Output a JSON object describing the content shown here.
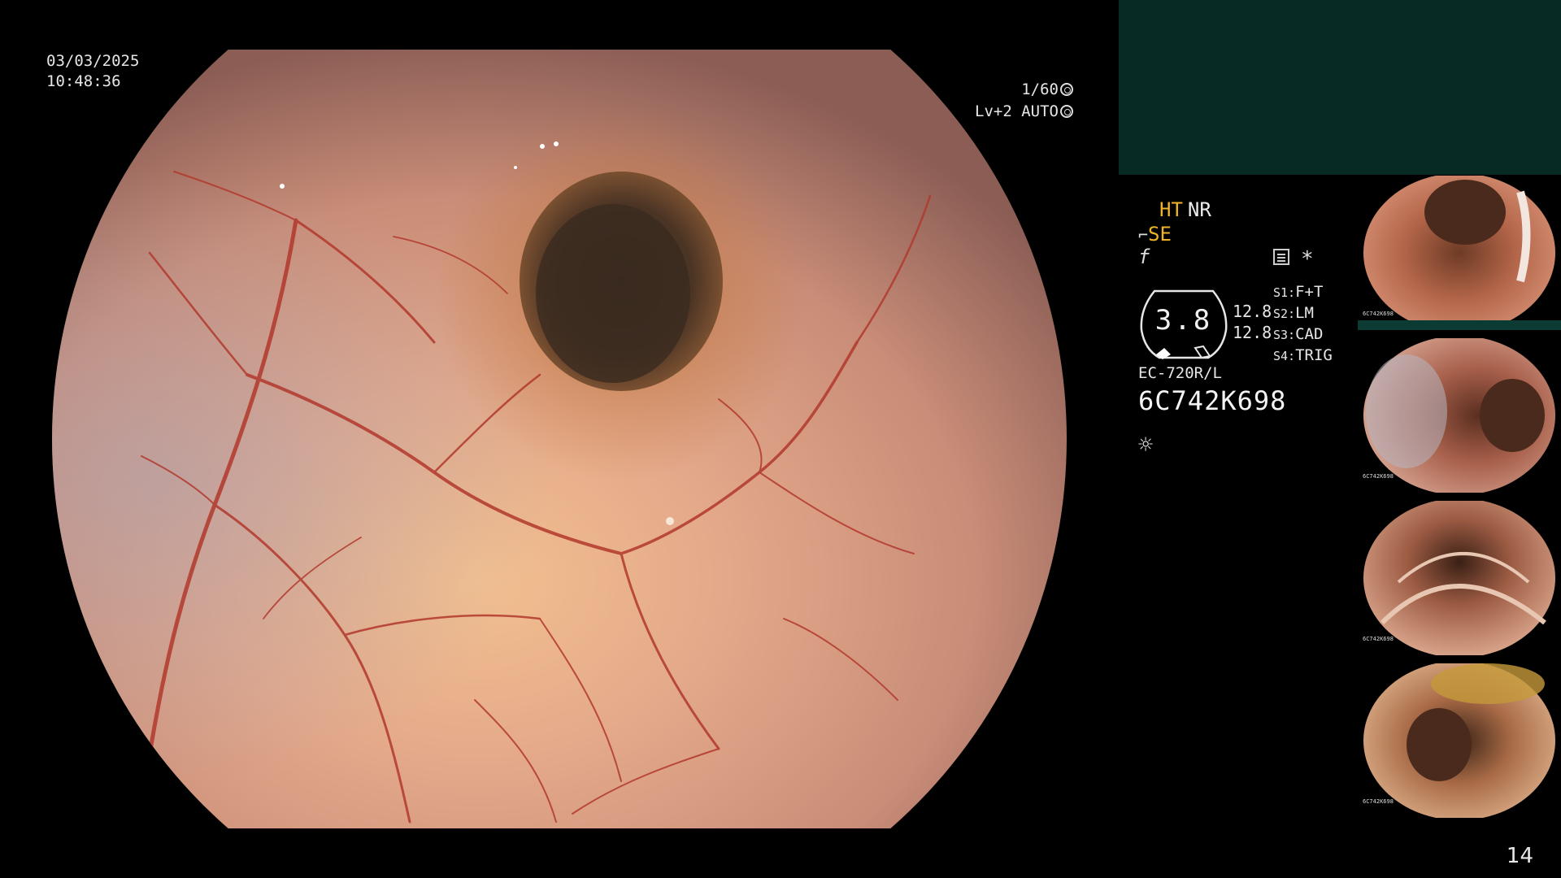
{
  "overlay": {
    "date": "03/03/2025",
    "time": "10:48:36",
    "shutter": "1/60",
    "level": "Lv+2 AUTO"
  },
  "status": {
    "ht": "HT",
    "nr": "NR",
    "se_glyph": "⌐",
    "se": "SE",
    "f_glyph": "f",
    "asterisk": "*",
    "gauge_value": "3.8",
    "value1": "12.8",
    "value2": "12.8",
    "slots": [
      {
        "key": "S1:",
        "value": "F+T"
      },
      {
        "key": "S2:",
        "value": "LM"
      },
      {
        "key": "S3:",
        "value": "CAD"
      },
      {
        "key": "S4:",
        "value": "TRIG"
      }
    ],
    "model": "EC-720R/L",
    "serial": "6C742K698",
    "light_icon": "sun-icon"
  },
  "thumbnails": [
    {
      "label": "6C742K698"
    },
    {
      "label": "6C742K698"
    },
    {
      "label": "6C742K698"
    },
    {
      "label": "6C742K698"
    }
  ],
  "page_number": "14",
  "colors": {
    "accent_yellow": "#f0b429",
    "panel_teal": "#072a25",
    "mucosa": "#d99a7e",
    "vessel": "#b2382c"
  }
}
